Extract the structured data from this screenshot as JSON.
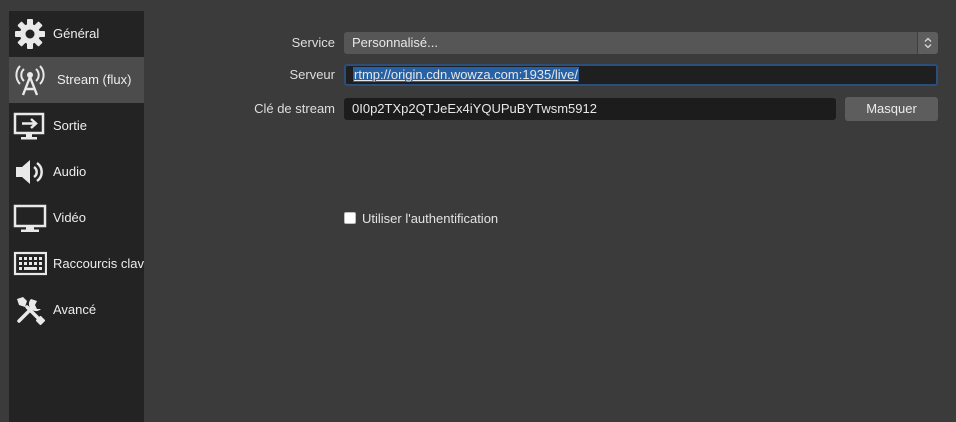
{
  "sidebar": {
    "items": [
      {
        "label": "Général",
        "icon": "gear-icon"
      },
      {
        "label": "Stream (flux)",
        "icon": "antenna-icon",
        "selected": true
      },
      {
        "label": "Sortie",
        "icon": "output-icon"
      },
      {
        "label": "Audio",
        "icon": "speaker-icon"
      },
      {
        "label": "Vidéo",
        "icon": "monitor-icon"
      },
      {
        "label": "Raccourcis clavier",
        "icon": "keyboard-icon"
      },
      {
        "label": "Avancé",
        "icon": "tools-icon"
      }
    ]
  },
  "form": {
    "service_label": "Service",
    "service_value": "Personnalisé...",
    "server_label": "Serveur",
    "server_value": "rtmp://origin.cdn.wowza.com:1935/live/",
    "key_label": "Clé de stream",
    "key_value": "0I0p2TXp2QTJeEx4iYQUPuBYTwsm5912",
    "hide_button": "Masquer",
    "auth_label": "Utiliser l'authentification",
    "auth_checked": false
  },
  "colors": {
    "background": "#3b3b3b",
    "sidebar": "#232323",
    "selected_item": "#4c4c4c",
    "selection_highlight": "#2761a5",
    "focus_border": "#2b4f7a"
  }
}
